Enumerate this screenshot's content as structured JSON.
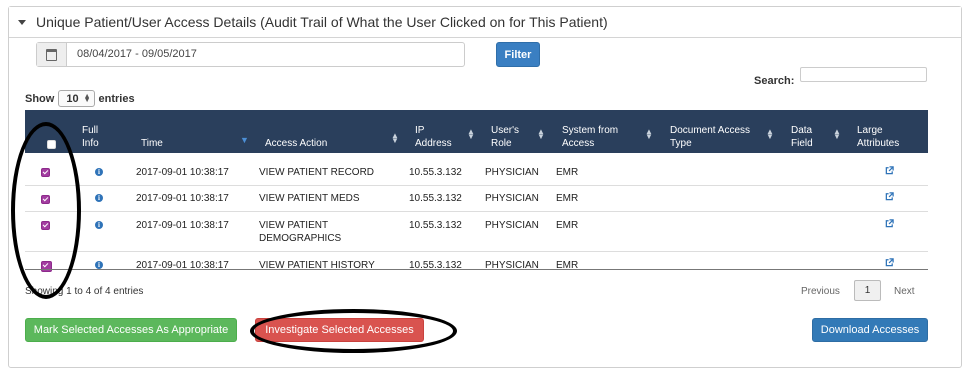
{
  "panel": {
    "title": "Unique Patient/User Access Details (Audit Trail of What the User Clicked on for This Patient)"
  },
  "filter": {
    "date_range": "08/04/2017 - 09/05/2017",
    "button_label": "Filter"
  },
  "search": {
    "label": "Search:",
    "value": ""
  },
  "length": {
    "prefix": "Show",
    "value": "10",
    "suffix": "entries"
  },
  "table": {
    "headers": {
      "full_info": [
        "Full",
        "Info"
      ],
      "time": "Time",
      "access_action": "Access Action",
      "ip_address": [
        "IP",
        "Address"
      ],
      "users_role": [
        "User's",
        "Role"
      ],
      "system_from_access": [
        "System from",
        "Access"
      ],
      "document_access_type": [
        "Document Access",
        "Type"
      ],
      "data_field": [
        "Data",
        "Field"
      ],
      "large_attributes": [
        "Large",
        "Attributes"
      ]
    },
    "rows": [
      {
        "checked": true,
        "time": "2017-09-01 10:38:17",
        "action": [
          "VIEW PATIENT RECORD"
        ],
        "ip": "10.55.3.132",
        "role": "PHYSICIAN",
        "system": "EMR"
      },
      {
        "checked": true,
        "time": "2017-09-01 10:38:17",
        "action": [
          "VIEW PATIENT MEDS"
        ],
        "ip": "10.55.3.132",
        "role": "PHYSICIAN",
        "system": "EMR"
      },
      {
        "checked": true,
        "time": "2017-09-01 10:38:17",
        "action": [
          "VIEW PATIENT",
          "DEMOGRAPHICS"
        ],
        "ip": "10.55.3.132",
        "role": "PHYSICIAN",
        "system": "EMR"
      },
      {
        "checked": true,
        "time": "2017-09-01 10:38:17",
        "action": [
          "VIEW PATIENT HISTORY"
        ],
        "ip": "10.55.3.132",
        "role": "PHYSICIAN",
        "system": "EMR"
      }
    ]
  },
  "footer": {
    "info": "Showing 1 to 4 of 4 entries",
    "pagination": {
      "previous": "Previous",
      "current": "1",
      "next": "Next"
    }
  },
  "actions": {
    "mark_appropriate": "Mark Selected Accesses As Appropriate",
    "investigate": "Investigate Selected Accesses",
    "download": "Download Accesses"
  },
  "icons": {
    "info": "info-icon",
    "external_link": "external-link-icon",
    "calendar": "calendar-icon",
    "caret": "caret-down-icon"
  },
  "colors": {
    "header_bg": "#2a3f5c",
    "checkbox": "#a23da0",
    "green": "#5cb85c",
    "red": "#d9534f",
    "blue": "#337ab7"
  }
}
